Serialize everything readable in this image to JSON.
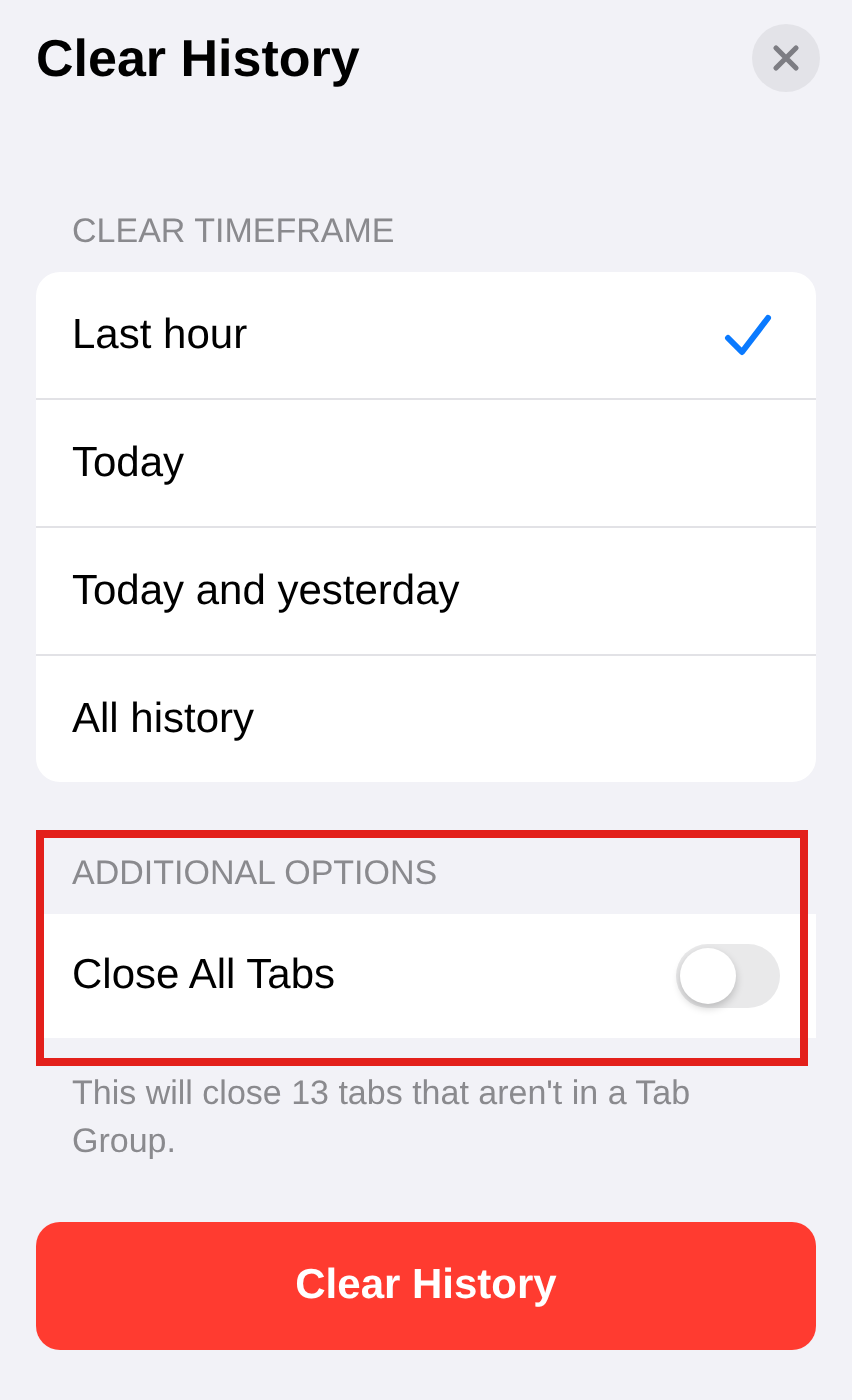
{
  "title": "Clear History",
  "timeframe": {
    "header": "CLEAR TIMEFRAME",
    "options": [
      {
        "label": "Last hour",
        "selected": true
      },
      {
        "label": "Today",
        "selected": false
      },
      {
        "label": "Today and yesterday",
        "selected": false
      },
      {
        "label": "All history",
        "selected": false
      }
    ]
  },
  "additional": {
    "header": "ADDITIONAL OPTIONS",
    "highlighted": true,
    "toggle": {
      "label": "Close All Tabs",
      "on": false
    },
    "note": "This will close 13 tabs that aren't in a Tab Group."
  },
  "action_button": "Clear History"
}
